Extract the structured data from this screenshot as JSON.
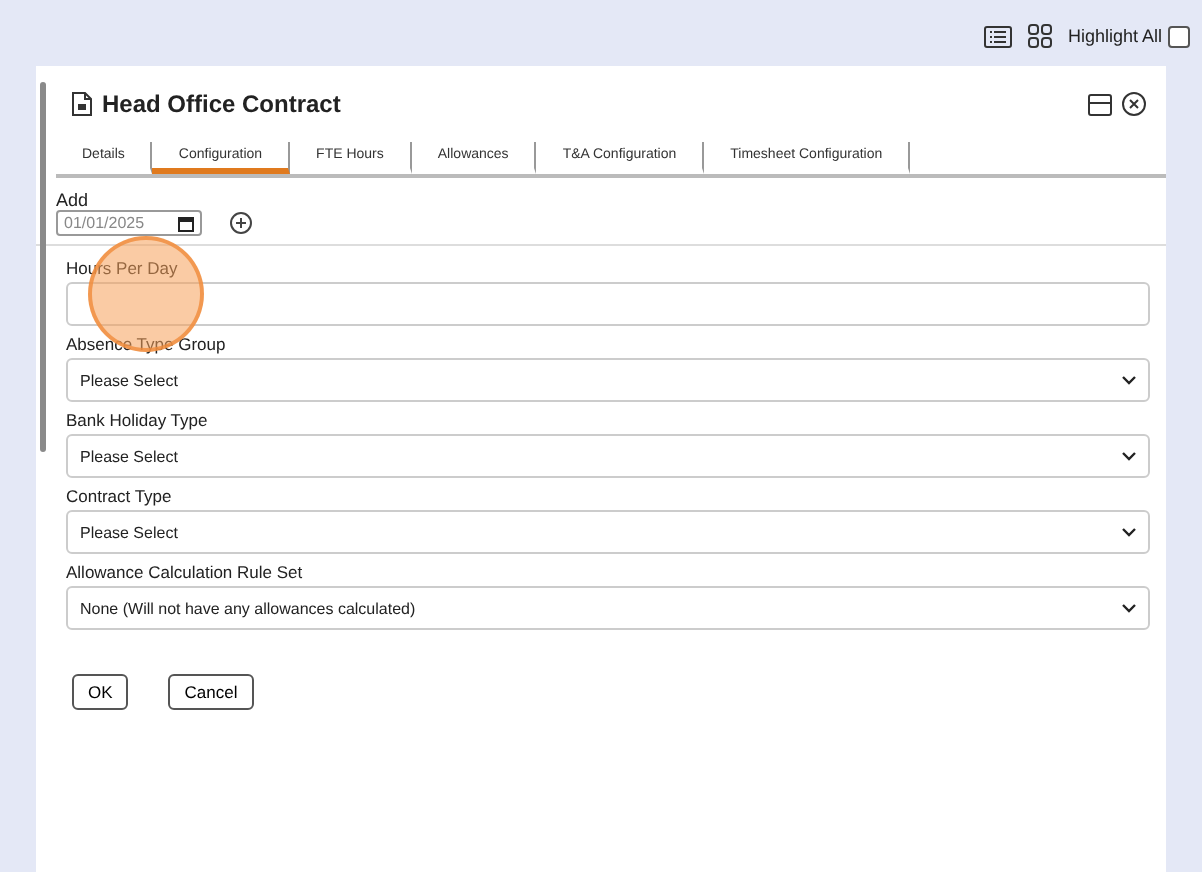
{
  "toolbar": {
    "highlight_all": {
      "label": "Highlight All",
      "checked": false
    }
  },
  "dialog": {
    "title": "Head Office Contract",
    "tabs": [
      {
        "label": "Details",
        "selected": false
      },
      {
        "label": "Configuration",
        "selected": true
      },
      {
        "label": "FTE Hours",
        "selected": false
      },
      {
        "label": "Allowances",
        "selected": false
      },
      {
        "label": "T&A Configuration",
        "selected": false
      },
      {
        "label": "Timesheet Configuration",
        "selected": false
      }
    ],
    "add": {
      "label": "Add",
      "date_value": "01/01/2025"
    },
    "fields": [
      {
        "label": "Hours Per Day",
        "kind": "text"
      },
      {
        "label": "Absence Type Group",
        "kind": "select",
        "value": "Please Select"
      },
      {
        "label": "Bank Holiday Type",
        "kind": "select",
        "value": "Please Select"
      },
      {
        "label": "Contract Type",
        "kind": "select",
        "value": "Please Select"
      },
      {
        "label": "Allowance Calculation Rule Set",
        "kind": "select",
        "value": "None (Will not have any allowances calculated)"
      }
    ],
    "buttons": [
      "OK",
      "Cancel"
    ]
  }
}
